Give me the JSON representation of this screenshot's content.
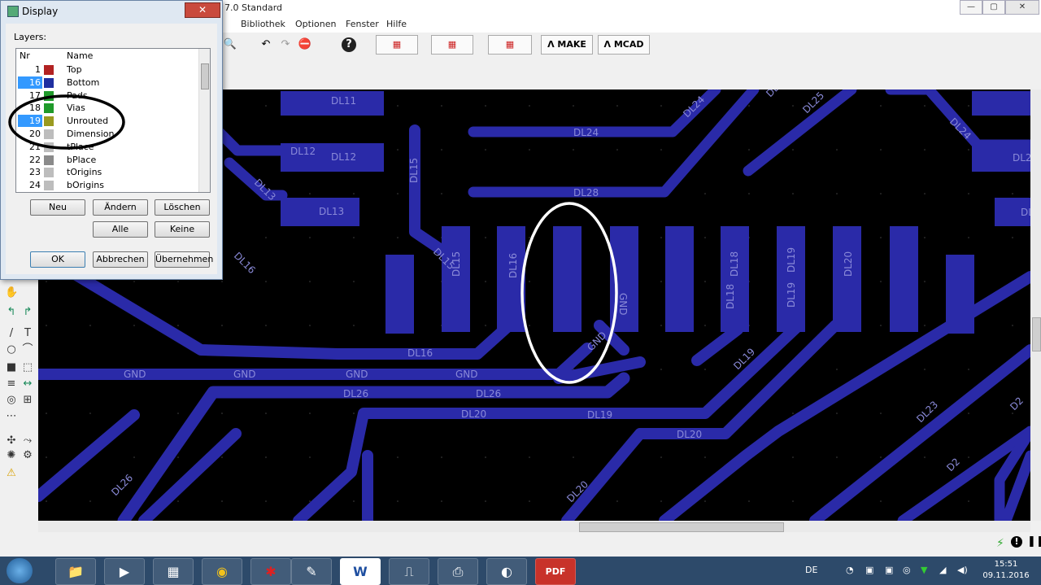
{
  "window": {
    "title": "7.0 Standard",
    "controls": {
      "minimize": "—",
      "maximize": "▢",
      "close": "✕"
    }
  },
  "menu": [
    "Bibliothek",
    "Optionen",
    "Fenster",
    "Hilfe"
  ],
  "toolbar": {
    "make_label": "MAKE",
    "mcad_label": "MCAD",
    "buttons": [
      {
        "name": "zoom-icon",
        "glyph": "🔍"
      },
      {
        "name": "undo-icon",
        "glyph": "↶"
      },
      {
        "name": "redo-icon",
        "glyph": "↷"
      },
      {
        "name": "stop-icon",
        "glyph": "⛔"
      },
      {
        "name": "help-icon",
        "glyph": "?"
      }
    ]
  },
  "dialog": {
    "title": "Display",
    "close": "✕",
    "layers_label": "Layers:",
    "columns": {
      "nr": "Nr",
      "name": "Name"
    },
    "layers": [
      {
        "nr": "1",
        "name": "Top",
        "color": "#b22222",
        "selected": false
      },
      {
        "nr": "16",
        "name": "Bottom",
        "color": "#1f2fa0",
        "selected": true
      },
      {
        "nr": "17",
        "name": "Pads",
        "color": "#1f9a2a",
        "selected": false
      },
      {
        "nr": "18",
        "name": "Vias",
        "color": "#1f9a2a",
        "selected": false
      },
      {
        "nr": "19",
        "name": "Unrouted",
        "color": "#9a9a20",
        "selected": true
      },
      {
        "nr": "20",
        "name": "Dimension",
        "color": "#bdbdbd",
        "selected": false
      },
      {
        "nr": "21",
        "name": "tPlace",
        "color": "#bdbdbd",
        "selected": false
      },
      {
        "nr": "22",
        "name": "bPlace",
        "color": "#8a8a8a",
        "selected": false
      },
      {
        "nr": "23",
        "name": "tOrigins",
        "color": "#bdbdbd",
        "selected": false
      },
      {
        "nr": "24",
        "name": "bOrigins",
        "color": "#bdbdbd",
        "selected": false
      }
    ],
    "buttons": {
      "neu": "Neu",
      "aendern": "Ändern",
      "loeschen": "Löschen",
      "alle": "Alle",
      "keine": "Keine",
      "ok": "OK",
      "abbrechen": "Abbrechen",
      "uebernehmen": "Übernehmen"
    }
  },
  "pcb": {
    "trace_color": "#2a2aa8",
    "label_color": "#8a8ad8",
    "labels": [
      {
        "t": "DL11"
      },
      {
        "t": "DL12"
      },
      {
        "t": "DL12"
      },
      {
        "t": "DL13"
      },
      {
        "t": "DL13"
      },
      {
        "t": "DL24"
      },
      {
        "t": "DL24"
      },
      {
        "t": "DL24"
      },
      {
        "t": "DL25"
      },
      {
        "t": "DL28"
      },
      {
        "t": "DL15"
      },
      {
        "t": "DL15"
      },
      {
        "t": "DL15"
      },
      {
        "t": "DL16"
      },
      {
        "t": "DL16"
      },
      {
        "t": "DL16"
      },
      {
        "t": "GND"
      },
      {
        "t": "GND"
      },
      {
        "t": "GND"
      },
      {
        "t": "GND"
      },
      {
        "t": "GND"
      },
      {
        "t": "GND"
      },
      {
        "t": "DL18"
      },
      {
        "t": "DL18"
      },
      {
        "t": "DL19"
      },
      {
        "t": "DL19"
      },
      {
        "t": "DL19"
      },
      {
        "t": "DL19"
      },
      {
        "t": "DL20"
      },
      {
        "t": "DL26"
      },
      {
        "t": "DL26"
      },
      {
        "t": "DL26"
      },
      {
        "t": "DL20"
      },
      {
        "t": "DL20"
      },
      {
        "t": "DL20"
      },
      {
        "t": "DL23"
      },
      {
        "t": "D2"
      },
      {
        "t": "D2"
      },
      {
        "t": "DL2"
      },
      {
        "t": "DL2"
      },
      {
        "t": "DL"
      }
    ]
  },
  "palette": [
    {
      "name": "move-icon",
      "glyph": "✋"
    },
    {
      "name": "route-icon",
      "glyph": "↰"
    },
    {
      "name": "ripup-icon",
      "glyph": "↱"
    },
    {
      "name": "wire-icon",
      "glyph": "/"
    },
    {
      "name": "text-icon",
      "glyph": "T"
    },
    {
      "name": "circle-icon",
      "glyph": "○"
    },
    {
      "name": "arc-icon",
      "glyph": "⌒"
    },
    {
      "name": "rect-icon",
      "glyph": "■"
    },
    {
      "name": "polygon-icon",
      "glyph": "⬚"
    },
    {
      "name": "via-icon",
      "glyph": "≡"
    },
    {
      "name": "signal-icon",
      "glyph": "↔"
    },
    {
      "name": "hole-icon",
      "glyph": "◎"
    },
    {
      "name": "attribute-icon",
      "glyph": "⊞"
    },
    {
      "name": "dimension-icon",
      "glyph": "⋯"
    },
    {
      "name": "ratsnest-icon",
      "glyph": "✣"
    },
    {
      "name": "autorouter-icon",
      "glyph": "⤳"
    },
    {
      "name": "optimize-icon",
      "glyph": "✺"
    },
    {
      "name": "drc-icon",
      "glyph": "⚙"
    },
    {
      "name": "errors-icon",
      "glyph": "⚠"
    }
  ],
  "taskbar": {
    "apps": [
      {
        "name": "explorer-icon",
        "glyph": "📁"
      },
      {
        "name": "media-icon",
        "glyph": "▶"
      },
      {
        "name": "calculator-icon",
        "glyph": "▦"
      },
      {
        "name": "chrome-icon",
        "glyph": "◉"
      },
      {
        "name": "paint-icon",
        "glyph": "✱"
      },
      {
        "name": "notepad-icon",
        "glyph": "✎"
      },
      {
        "name": "word-icon",
        "glyph": "W"
      },
      {
        "name": "eagle-schematic-icon",
        "glyph": "⎍"
      },
      {
        "name": "network-icon",
        "glyph": "⎙"
      },
      {
        "name": "app-red-icon",
        "glyph": "◐"
      },
      {
        "name": "pdf-icon",
        "glyph": "PDF"
      }
    ],
    "lang": "DE",
    "time": "15:51",
    "date": "09.11.2016"
  }
}
